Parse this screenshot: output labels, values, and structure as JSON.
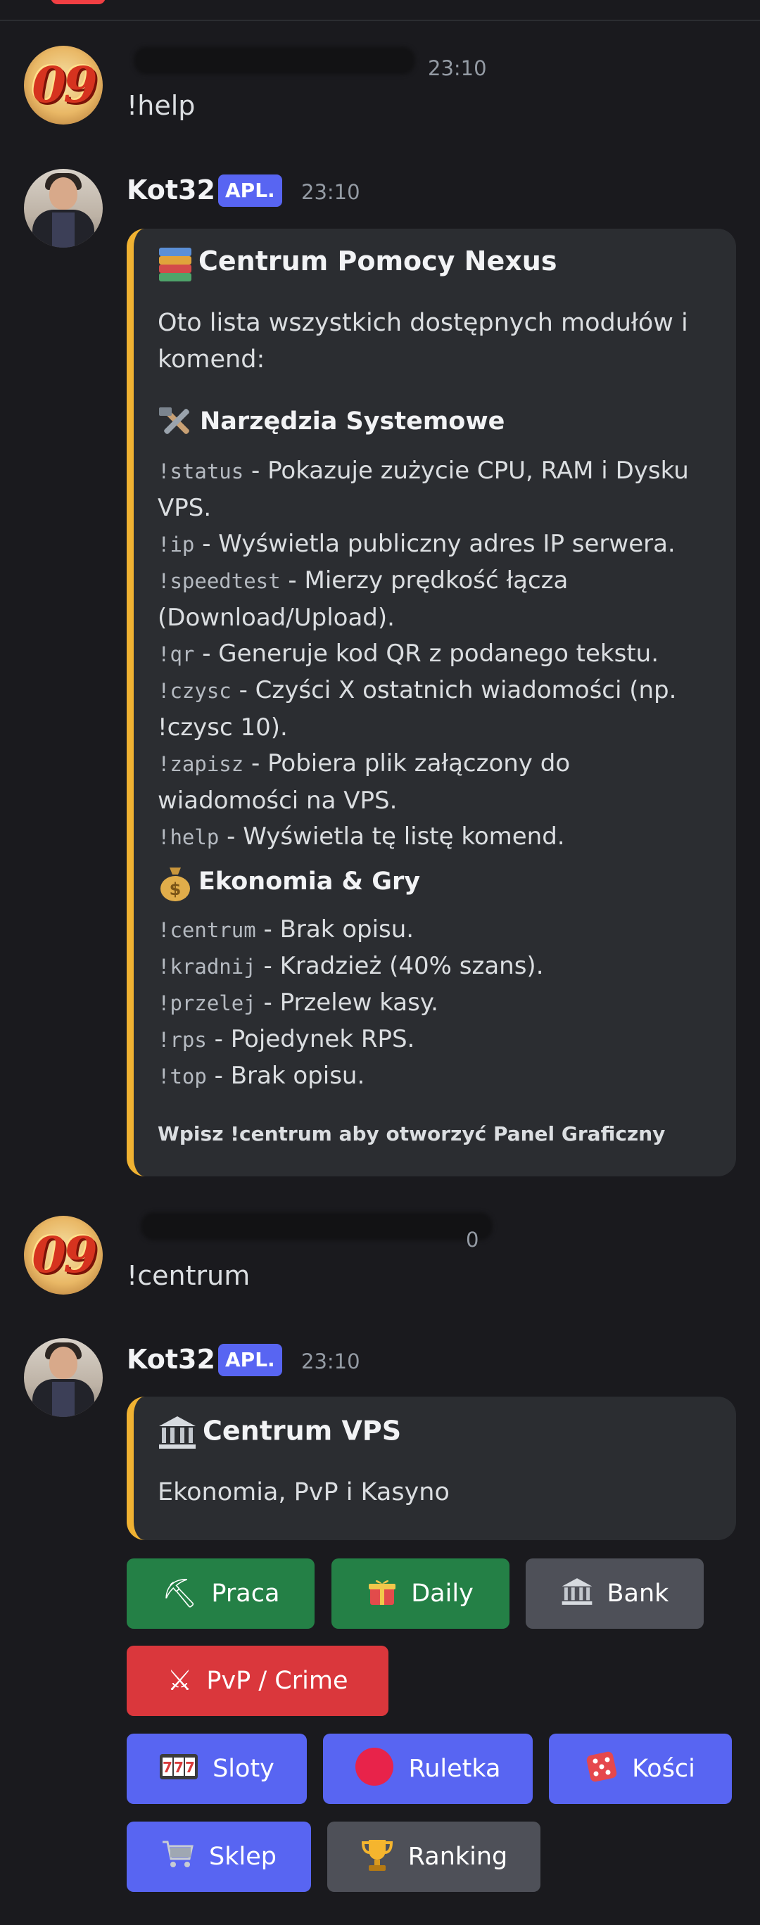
{
  "messages": {
    "m1": {
      "time_partial": "23:10",
      "text": "!help"
    },
    "m2": {
      "username": "Kot32",
      "tag": "APL.",
      "time": "23:10",
      "embed": {
        "title": "Centrum Pomocy Nexus",
        "description": "Oto lista wszystkich dostępnych modułów i komend:",
        "fields": [
          {
            "name": "Narzędzia Systemowe",
            "icon": "tools-icon",
            "lines": [
              {
                "cmd": "!status",
                "text": " - Pokazuje zużycie CPU, RAM i Dysku VPS."
              },
              {
                "cmd": "!ip",
                "text": " - Wyświetla publiczny adres IP serwera."
              },
              {
                "cmd": "!speedtest",
                "text": " - Mierzy prędkość łącza (Download/Upload)."
              },
              {
                "cmd": "!qr",
                "text": " - Generuje kod QR z podanego tekstu."
              },
              {
                "cmd": "!czysc",
                "text": " - Czyści X ostatnich wiadomości (np. !czysc 10)."
              },
              {
                "cmd": "!zapisz",
                "text": " - Pobiera plik załączony do wiadomości na VPS."
              },
              {
                "cmd": "!help",
                "text": " - Wyświetla tę listę komend."
              }
            ]
          },
          {
            "name": "Ekonomia & Gry",
            "icon": "money-bag-icon",
            "lines": [
              {
                "cmd": "!centrum",
                "text": " - Brak opisu."
              },
              {
                "cmd": "!kradnij",
                "text": " - Kradzież (40% szans)."
              },
              {
                "cmd": "!przelej",
                "text": " - Przelew kasy."
              },
              {
                "cmd": "!rps",
                "text": " - Pojedynek RPS."
              },
              {
                "cmd": "!top",
                "text": " - Brak opisu."
              }
            ]
          }
        ],
        "footer": "Wpisz !centrum aby otworzyć Panel Graficzny"
      }
    },
    "m3": {
      "time_partial": "0",
      "text": "!centrum"
    },
    "m4": {
      "username": "Kot32",
      "tag": "APL.",
      "time": "23:10",
      "embed": {
        "title": "Centrum VPS",
        "description": "Ekonomia, PvP i Kasyno"
      },
      "buttons": {
        "praca": "Praca",
        "daily": "Daily",
        "bank": "Bank",
        "pvp": "PvP / Crime",
        "sloty": "Sloty",
        "ruletka": "Ruletka",
        "kosci": "Kości",
        "sklep": "Sklep",
        "ranking": "Ranking"
      }
    }
  },
  "colors": {
    "background": "#1a1a1e",
    "embed_bg": "#2b2d31",
    "embed_accent": "#f0b232",
    "tag": "#5865f2",
    "green": "#248046",
    "gray": "#4e5058",
    "red": "#da373c",
    "blurple": "#5865f2"
  }
}
